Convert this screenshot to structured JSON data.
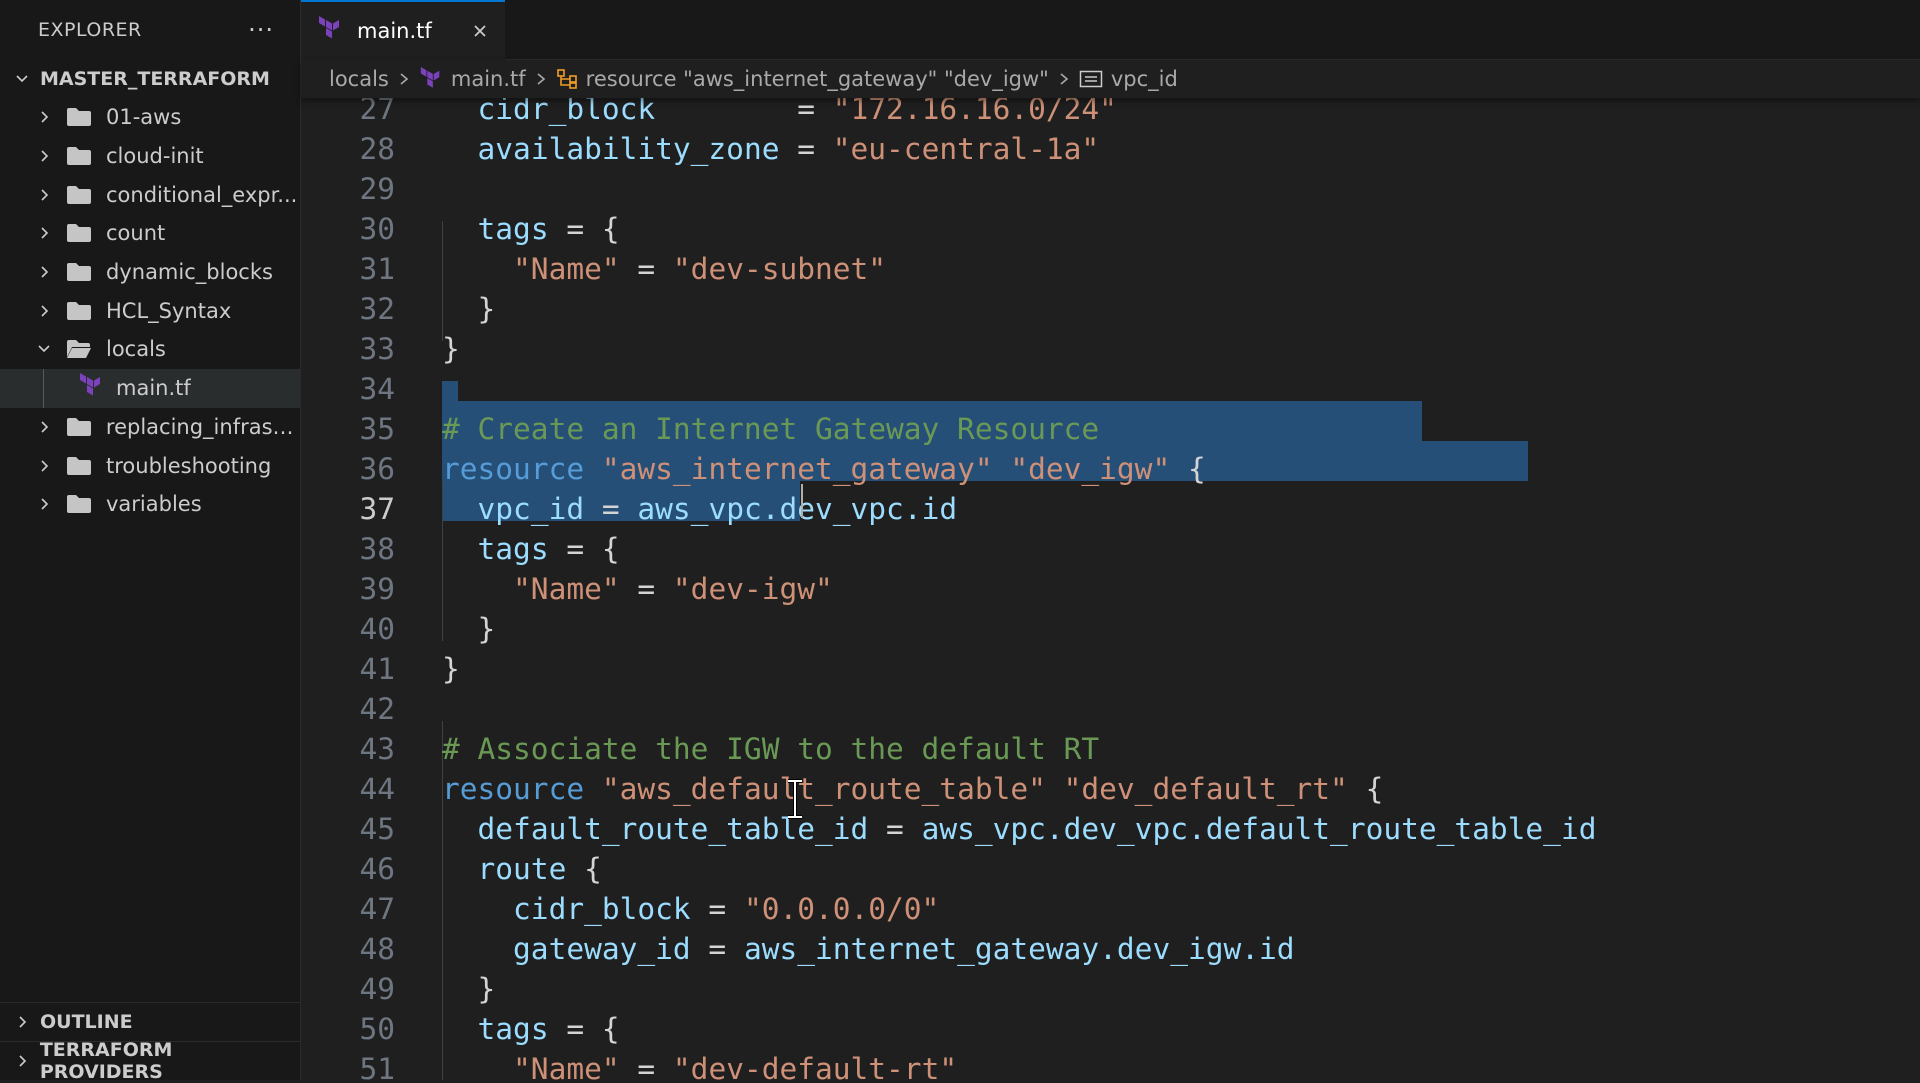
{
  "explorer": {
    "title": "EXPLORER",
    "more_label": "···",
    "project": "MASTER_TERRAFORM",
    "items": [
      {
        "label": "01-aws",
        "type": "folder",
        "expanded": false
      },
      {
        "label": "cloud-init",
        "type": "folder",
        "expanded": false
      },
      {
        "label": "conditional_expr...",
        "type": "folder",
        "expanded": false
      },
      {
        "label": "count",
        "type": "folder",
        "expanded": false
      },
      {
        "label": "dynamic_blocks",
        "type": "folder",
        "expanded": false
      },
      {
        "label": "HCL_Syntax",
        "type": "folder",
        "expanded": false
      },
      {
        "label": "locals",
        "type": "folder",
        "expanded": true
      },
      {
        "label": "main.tf",
        "type": "file",
        "selected": true
      },
      {
        "label": "replacing_infrast...",
        "type": "folder",
        "expanded": false
      },
      {
        "label": "troubleshooting",
        "type": "folder",
        "expanded": false
      },
      {
        "label": "variables",
        "type": "folder",
        "expanded": false
      }
    ],
    "outline_label": "OUTLINE",
    "providers_label": "TERRAFORM PROVIDERS"
  },
  "tab": {
    "label": "main.tf"
  },
  "breadcrumb": {
    "folder": "locals",
    "file": "main.tf",
    "resource": "resource \"aws_internet_gateway\" \"dev_igw\"",
    "attr": "vpc_id"
  },
  "editor": {
    "active_line": 37,
    "lines": [
      {
        "n": 27,
        "code": "  cidr_block        = \"172.16.16.0/24\""
      },
      {
        "n": 28,
        "code": "  availability_zone = \"eu-central-1a\""
      },
      {
        "n": 29,
        "code": ""
      },
      {
        "n": 30,
        "code": "  tags = {"
      },
      {
        "n": 31,
        "code": "    \"Name\" = \"dev-subnet\""
      },
      {
        "n": 32,
        "code": "  }"
      },
      {
        "n": 33,
        "code": "}"
      },
      {
        "n": 34,
        "code": ""
      },
      {
        "n": 35,
        "code": "# Create an Internet Gateway Resource"
      },
      {
        "n": 36,
        "code": "resource \"aws_internet_gateway\" \"dev_igw\" {"
      },
      {
        "n": 37,
        "code": "  vpc_id = aws_vpc.dev_vpc.id"
      },
      {
        "n": 38,
        "code": "  tags = {"
      },
      {
        "n": 39,
        "code": "    \"Name\" = \"dev-igw\""
      },
      {
        "n": 40,
        "code": "  }"
      },
      {
        "n": 41,
        "code": "}"
      },
      {
        "n": 42,
        "code": ""
      },
      {
        "n": 43,
        "code": "# Associate the IGW to the default RT"
      },
      {
        "n": 44,
        "code": "resource \"aws_default_route_table\" \"dev_default_rt\" {"
      },
      {
        "n": 45,
        "code": "  default_route_table_id = aws_vpc.dev_vpc.default_route_table_id"
      },
      {
        "n": 46,
        "code": "  route {"
      },
      {
        "n": 47,
        "code": "    cidr_block = \"0.0.0.0/0\""
      },
      {
        "n": 48,
        "code": "    gateway_id = aws_internet_gateway.dev_igw.id"
      },
      {
        "n": 49,
        "code": "  }"
      },
      {
        "n": 50,
        "code": "  tags = {"
      },
      {
        "n": 51,
        "code": "    \"Name\" = \"dev-default-rt\""
      }
    ]
  },
  "colors": {
    "selection": "#264f78",
    "string": "#ce9178",
    "keyword": "#569cd6",
    "comment": "#6a9955",
    "attribute": "#9cdcfe",
    "terraform_logo": "#7b42bc",
    "tab_accent": "#0078d4"
  }
}
